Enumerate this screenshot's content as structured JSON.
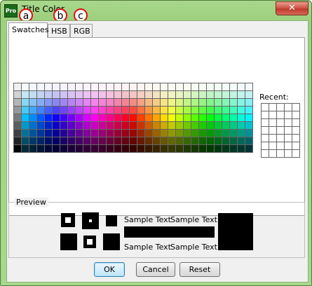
{
  "window": {
    "title": "Title Color",
    "app_icon_text": "Pro",
    "close_label": "✕"
  },
  "annotations": [
    "a",
    "b",
    "c"
  ],
  "tabs": [
    {
      "label": "Swatches",
      "active": true
    },
    {
      "label": "HSB",
      "active": false
    },
    {
      "label": "RGB",
      "active": false
    }
  ],
  "swatches": {
    "recent_label": "Recent:",
    "recent_rows": 7,
    "recent_cols": 5
  },
  "preview": {
    "label": "Preview",
    "sample_text": "Sample Text",
    "foreground_color": "#000000",
    "background_color": "#ffffff"
  },
  "buttons": {
    "ok": "OK",
    "cancel": "Cancel",
    "reset": "Reset"
  },
  "colors": {
    "title_bg": "#a7d98c",
    "close_btn": "#c0392b",
    "annotation_ring": "#dd1111"
  }
}
